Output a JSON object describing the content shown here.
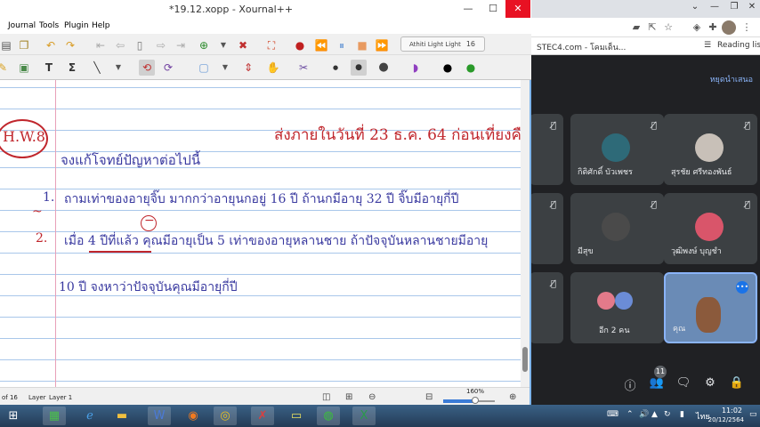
{
  "xournal": {
    "title": "*19.12.xopp - Xournal++",
    "menu": [
      "Journal",
      "Tools",
      "Plugin",
      "Help"
    ],
    "font_name": "Athiti Light Light",
    "font_size": "16",
    "page": {
      "hw_label": "H.W.8",
      "deadline": "ส่งภายในวันที่ 23 ธ.ค. 64 ก่อนเที่ยงคืน",
      "instruction": "จงแก้โจทย์ปัญหาต่อไปนี้",
      "num1": "1.",
      "problem1": "ถามเท่าของอายุจิ๊บ มากกว่าอายุนกอยู่ 16 ปี ถ้านกมีอายุ 32 ปี จิ๊บมีอายุกี่ปี",
      "num2": "2.",
      "problem2": "เมื่อ 4 ปีที่แล้ว คุณมีอายุเป็น 5 เท่าของอายุหลานชาย ถ้าปัจจุบันหลานชายมีอายุ",
      "problem2b": "10 ปี จงหาว่าปัจจุบันคุณมีอายุกี่ปี",
      "squiggle": "~",
      "minus_mark": "−"
    },
    "status": {
      "page_of": "of 16",
      "layer_label": "Layer",
      "layer_value": "Layer 1",
      "zoom": "160%",
      "zoom_fraction": 0.62
    }
  },
  "chrome": {
    "bookmark_item": "STEC4.com - โคมเด็น...",
    "reading_list": "Reading list",
    "meet": {
      "header": "หยุดนำเสนอ",
      "tiles": [
        {
          "name": "",
          "muted": true
        },
        {
          "name": "กิติศักดิ์ บัวเพชร",
          "muted": true
        },
        {
          "name": "สุรชัย ศรีทองพันธ์",
          "muted": true
        },
        {
          "name": "",
          "muted": true
        },
        {
          "name": "มีสุข",
          "muted": true
        },
        {
          "name": "วุฒิพงษ์ บุญชำ",
          "muted": true
        },
        {
          "name": "",
          "muted": true
        },
        {
          "name": "อีก 2 คน",
          "muted": false
        },
        {
          "name": "คุณ",
          "muted": false
        }
      ],
      "participant_count": "11"
    }
  },
  "taskbar": {
    "language": "ไทย",
    "time": "11:02",
    "date": "20/12/2564"
  }
}
